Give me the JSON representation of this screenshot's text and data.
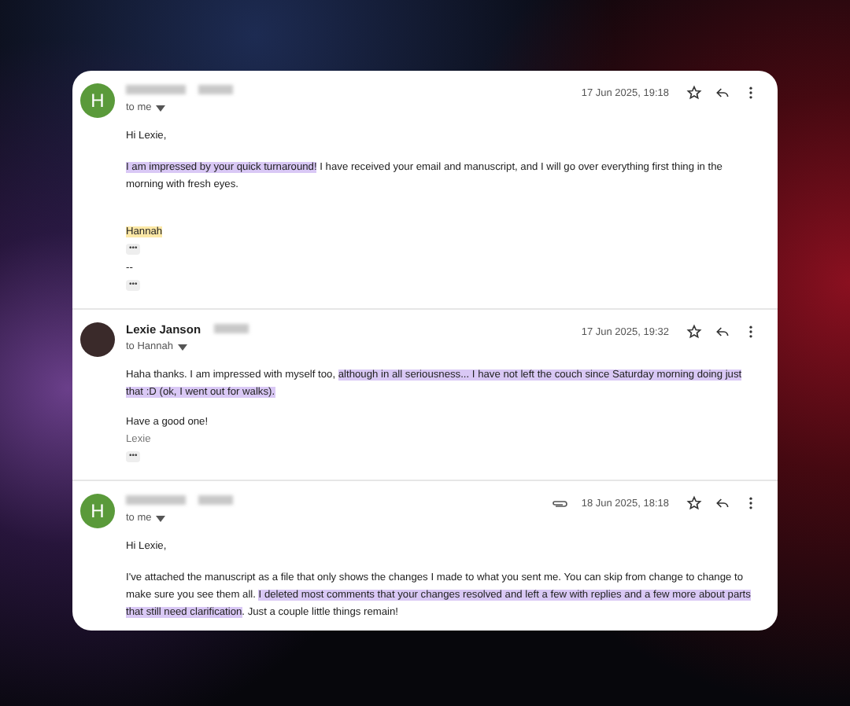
{
  "messages": [
    {
      "avatar": {
        "kind": "letter",
        "letter": "H"
      },
      "recipient": "to me",
      "has_attachment": false,
      "date": "17 Jun 2025, 19:18",
      "blocks": [
        {
          "kind": "greeting",
          "muted": false,
          "segments": [
            {
              "text": "Hi Lexie,",
              "highlighted": false
            }
          ]
        },
        {
          "kind": "paragraph",
          "muted": false,
          "segments": [
            {
              "text": "I am impressed by your quick turnaround!",
              "highlighted": true,
              "color": "#d9c8f5"
            },
            {
              "text": " I have received your email and manuscript, and I will go over everything first thing in the morning with fresh eyes.",
              "highlighted": false
            }
          ]
        },
        {
          "kind": "signature",
          "muted": false,
          "segments": [
            {
              "text": "Hannah",
              "highlighted": true,
              "color": "#fce8a6"
            }
          ]
        },
        {
          "kind": "more",
          "text": "•••"
        },
        {
          "kind": "separator",
          "muted": false,
          "segments": [
            {
              "text": "--",
              "highlighted": false
            }
          ]
        },
        {
          "kind": "more",
          "text": "•••"
        }
      ]
    },
    {
      "avatar": {
        "kind": "photo"
      },
      "sender_name": "Lexie Janson",
      "recipient": "to Hannah",
      "has_attachment": false,
      "date": "17 Jun 2025, 19:32",
      "blocks": [
        {
          "kind": "paragraph",
          "muted": false,
          "segments": [
            {
              "text": "Haha thanks. I am impressed with myself too, ",
              "highlighted": false
            },
            {
              "text": "although in all seriousness... I have not left the couch since Saturday morning doing just that :D (ok, I went out for walks).",
              "highlighted": true,
              "color": "#d9c8f5"
            }
          ]
        },
        {
          "kind": "closing",
          "muted": false,
          "segments": [
            {
              "text": "Have a good one!",
              "highlighted": false
            }
          ]
        },
        {
          "kind": "name",
          "muted": true,
          "segments": [
            {
              "text": "Lexie",
              "highlighted": false
            }
          ]
        },
        {
          "kind": "more",
          "text": "•••"
        }
      ]
    },
    {
      "avatar": {
        "kind": "letter",
        "letter": "H"
      },
      "recipient": "to me",
      "has_attachment": true,
      "date": "18 Jun 2025, 18:18",
      "blocks": [
        {
          "kind": "greeting",
          "muted": false,
          "segments": [
            {
              "text": "Hi Lexie,",
              "highlighted": false
            }
          ]
        },
        {
          "kind": "paragraph",
          "muted": false,
          "segments": [
            {
              "text": "I've attached the manuscript as a file that only shows the changes I made to what you sent me. You can skip from change to change to make sure you see them all. ",
              "highlighted": false
            },
            {
              "text": "I deleted most comments that your changes resolved and left a few with replies and a few more about parts that still need clarification",
              "highlighted": true,
              "color": "#d9c8f5"
            },
            {
              "text": ". Just a couple little things remain!",
              "highlighted": false
            }
          ]
        }
      ]
    }
  ]
}
